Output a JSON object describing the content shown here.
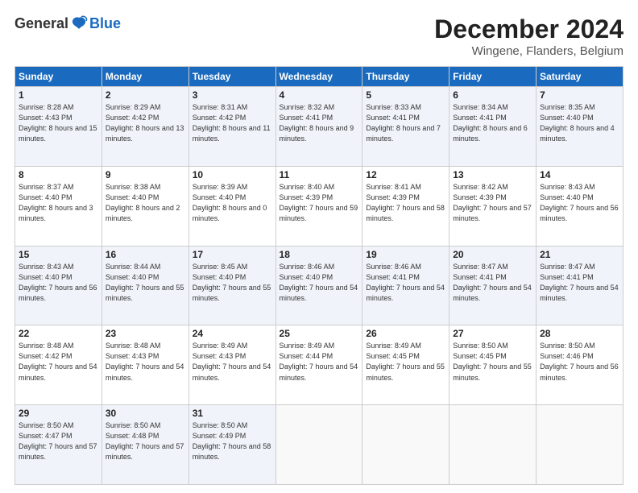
{
  "header": {
    "logo_general": "General",
    "logo_blue": "Blue",
    "month_title": "December 2024",
    "location": "Wingene, Flanders, Belgium"
  },
  "days_of_week": [
    "Sunday",
    "Monday",
    "Tuesday",
    "Wednesday",
    "Thursday",
    "Friday",
    "Saturday"
  ],
  "weeks": [
    [
      {
        "day": "1",
        "sunrise": "Sunrise: 8:28 AM",
        "sunset": "Sunset: 4:43 PM",
        "daylight": "Daylight: 8 hours and 15 minutes."
      },
      {
        "day": "2",
        "sunrise": "Sunrise: 8:29 AM",
        "sunset": "Sunset: 4:42 PM",
        "daylight": "Daylight: 8 hours and 13 minutes."
      },
      {
        "day": "3",
        "sunrise": "Sunrise: 8:31 AM",
        "sunset": "Sunset: 4:42 PM",
        "daylight": "Daylight: 8 hours and 11 minutes."
      },
      {
        "day": "4",
        "sunrise": "Sunrise: 8:32 AM",
        "sunset": "Sunset: 4:41 PM",
        "daylight": "Daylight: 8 hours and 9 minutes."
      },
      {
        "day": "5",
        "sunrise": "Sunrise: 8:33 AM",
        "sunset": "Sunset: 4:41 PM",
        "daylight": "Daylight: 8 hours and 7 minutes."
      },
      {
        "day": "6",
        "sunrise": "Sunrise: 8:34 AM",
        "sunset": "Sunset: 4:41 PM",
        "daylight": "Daylight: 8 hours and 6 minutes."
      },
      {
        "day": "7",
        "sunrise": "Sunrise: 8:35 AM",
        "sunset": "Sunset: 4:40 PM",
        "daylight": "Daylight: 8 hours and 4 minutes."
      }
    ],
    [
      {
        "day": "8",
        "sunrise": "Sunrise: 8:37 AM",
        "sunset": "Sunset: 4:40 PM",
        "daylight": "Daylight: 8 hours and 3 minutes."
      },
      {
        "day": "9",
        "sunrise": "Sunrise: 8:38 AM",
        "sunset": "Sunset: 4:40 PM",
        "daylight": "Daylight: 8 hours and 2 minutes."
      },
      {
        "day": "10",
        "sunrise": "Sunrise: 8:39 AM",
        "sunset": "Sunset: 4:40 PM",
        "daylight": "Daylight: 8 hours and 0 minutes."
      },
      {
        "day": "11",
        "sunrise": "Sunrise: 8:40 AM",
        "sunset": "Sunset: 4:39 PM",
        "daylight": "Daylight: 7 hours and 59 minutes."
      },
      {
        "day": "12",
        "sunrise": "Sunrise: 8:41 AM",
        "sunset": "Sunset: 4:39 PM",
        "daylight": "Daylight: 7 hours and 58 minutes."
      },
      {
        "day": "13",
        "sunrise": "Sunrise: 8:42 AM",
        "sunset": "Sunset: 4:39 PM",
        "daylight": "Daylight: 7 hours and 57 minutes."
      },
      {
        "day": "14",
        "sunrise": "Sunrise: 8:43 AM",
        "sunset": "Sunset: 4:40 PM",
        "daylight": "Daylight: 7 hours and 56 minutes."
      }
    ],
    [
      {
        "day": "15",
        "sunrise": "Sunrise: 8:43 AM",
        "sunset": "Sunset: 4:40 PM",
        "daylight": "Daylight: 7 hours and 56 minutes."
      },
      {
        "day": "16",
        "sunrise": "Sunrise: 8:44 AM",
        "sunset": "Sunset: 4:40 PM",
        "daylight": "Daylight: 7 hours and 55 minutes."
      },
      {
        "day": "17",
        "sunrise": "Sunrise: 8:45 AM",
        "sunset": "Sunset: 4:40 PM",
        "daylight": "Daylight: 7 hours and 55 minutes."
      },
      {
        "day": "18",
        "sunrise": "Sunrise: 8:46 AM",
        "sunset": "Sunset: 4:40 PM",
        "daylight": "Daylight: 7 hours and 54 minutes."
      },
      {
        "day": "19",
        "sunrise": "Sunrise: 8:46 AM",
        "sunset": "Sunset: 4:41 PM",
        "daylight": "Daylight: 7 hours and 54 minutes."
      },
      {
        "day": "20",
        "sunrise": "Sunrise: 8:47 AM",
        "sunset": "Sunset: 4:41 PM",
        "daylight": "Daylight: 7 hours and 54 minutes."
      },
      {
        "day": "21",
        "sunrise": "Sunrise: 8:47 AM",
        "sunset": "Sunset: 4:41 PM",
        "daylight": "Daylight: 7 hours and 54 minutes."
      }
    ],
    [
      {
        "day": "22",
        "sunrise": "Sunrise: 8:48 AM",
        "sunset": "Sunset: 4:42 PM",
        "daylight": "Daylight: 7 hours and 54 minutes."
      },
      {
        "day": "23",
        "sunrise": "Sunrise: 8:48 AM",
        "sunset": "Sunset: 4:43 PM",
        "daylight": "Daylight: 7 hours and 54 minutes."
      },
      {
        "day": "24",
        "sunrise": "Sunrise: 8:49 AM",
        "sunset": "Sunset: 4:43 PM",
        "daylight": "Daylight: 7 hours and 54 minutes."
      },
      {
        "day": "25",
        "sunrise": "Sunrise: 8:49 AM",
        "sunset": "Sunset: 4:44 PM",
        "daylight": "Daylight: 7 hours and 54 minutes."
      },
      {
        "day": "26",
        "sunrise": "Sunrise: 8:49 AM",
        "sunset": "Sunset: 4:45 PM",
        "daylight": "Daylight: 7 hours and 55 minutes."
      },
      {
        "day": "27",
        "sunrise": "Sunrise: 8:50 AM",
        "sunset": "Sunset: 4:45 PM",
        "daylight": "Daylight: 7 hours and 55 minutes."
      },
      {
        "day": "28",
        "sunrise": "Sunrise: 8:50 AM",
        "sunset": "Sunset: 4:46 PM",
        "daylight": "Daylight: 7 hours and 56 minutes."
      }
    ],
    [
      {
        "day": "29",
        "sunrise": "Sunrise: 8:50 AM",
        "sunset": "Sunset: 4:47 PM",
        "daylight": "Daylight: 7 hours and 57 minutes."
      },
      {
        "day": "30",
        "sunrise": "Sunrise: 8:50 AM",
        "sunset": "Sunset: 4:48 PM",
        "daylight": "Daylight: 7 hours and 57 minutes."
      },
      {
        "day": "31",
        "sunrise": "Sunrise: 8:50 AM",
        "sunset": "Sunset: 4:49 PM",
        "daylight": "Daylight: 7 hours and 58 minutes."
      },
      null,
      null,
      null,
      null
    ]
  ]
}
